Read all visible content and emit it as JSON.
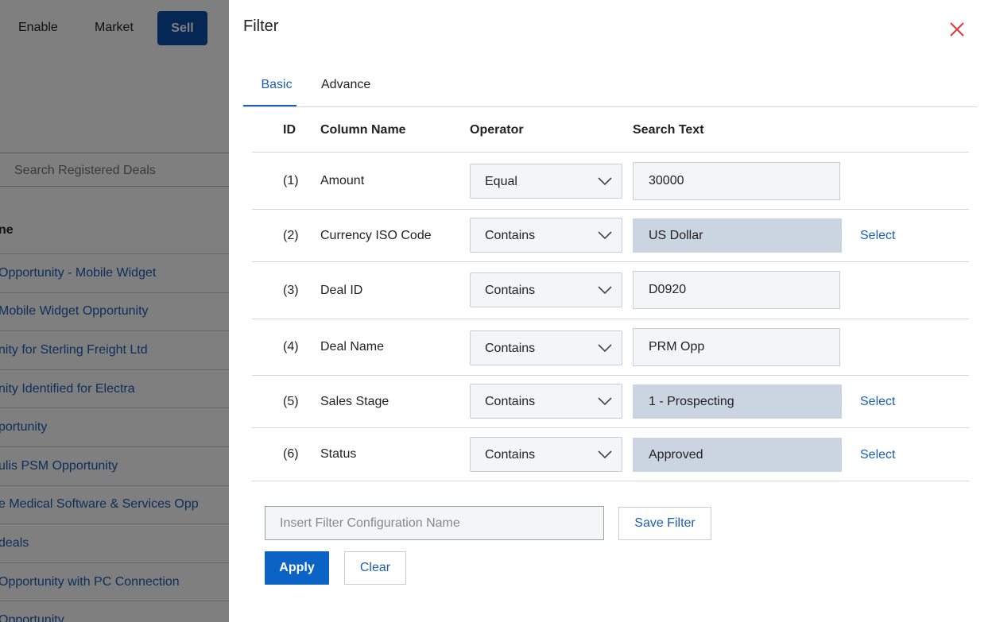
{
  "background": {
    "nav": {
      "enable": "Enable",
      "market": "Market",
      "sell": "Sell"
    },
    "search_placeholder": "Search Registered Deals",
    "column_header": "ne",
    "deals": [
      "Opportunity - Mobile Widget",
      "Mobile Widget Opportunity",
      "nity for Sterling Freight Ltd",
      "nity Identified for Electra",
      "portunity",
      "ulis PSM Opportunity",
      "e Medical Software & Services Opp",
      "deals",
      "Opportunity with PC Connection",
      "Opportunity"
    ]
  },
  "filter": {
    "title": "Filter",
    "tabs": {
      "basic": "Basic",
      "advance": "Advance"
    },
    "columns": {
      "id": "ID",
      "column_name": "Column Name",
      "operator": "Operator",
      "search_text": "Search Text"
    },
    "rows": [
      {
        "id": "(1)",
        "column": "Amount",
        "operator": "Equal",
        "value": "30000",
        "select": ""
      },
      {
        "id": "(2)",
        "column": "Currency ISO Code",
        "operator": "Contains",
        "value": "US Dollar",
        "select": "Select"
      },
      {
        "id": "(3)",
        "column": "Deal ID",
        "operator": "Contains",
        "value": "D0920",
        "select": ""
      },
      {
        "id": "(4)",
        "column": "Deal Name",
        "operator": "Contains",
        "value": "PRM Opp",
        "select": ""
      },
      {
        "id": "(5)",
        "column": "Sales Stage",
        "operator": "Contains",
        "value": "1 - Prospecting",
        "select": "Select"
      },
      {
        "id": "(6)",
        "column": "Status",
        "operator": "Contains",
        "value": "Approved",
        "select": "Select"
      }
    ],
    "config_placeholder": "Insert Filter Configuration Name",
    "save_filter": "Save Filter",
    "apply": "Apply",
    "clear": "Clear"
  },
  "colors": {
    "accent": "#1a5fb4",
    "primary_button": "#0b63c5",
    "close": "#e0393e"
  }
}
